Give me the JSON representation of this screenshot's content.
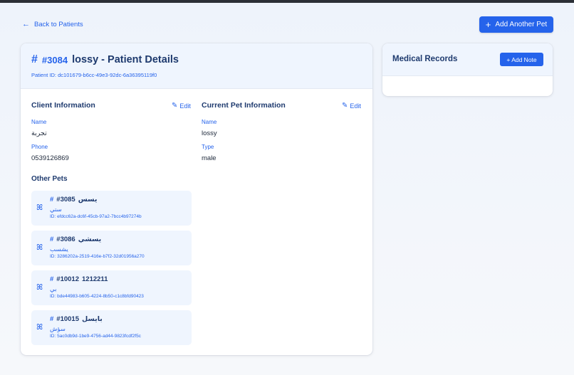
{
  "nav": {
    "back_label": "Back to Patients",
    "back_icon": "←"
  },
  "actions": {
    "add_pet_label": "Add Another Pet",
    "plus_icon": "+"
  },
  "patient": {
    "hash": "#",
    "number": "#3084",
    "title": "lossy - Patient Details",
    "id_text": "Patient ID: dc101679-b6cc-49e3-92dc-6a36395119f0"
  },
  "client": {
    "section_title": "Client Information",
    "edit_label": "Edit",
    "name_label": "Name",
    "name_value": "تجربة",
    "phone_label": "Phone",
    "phone_value": "0539126869"
  },
  "pet": {
    "section_title": "Current Pet Information",
    "edit_label": "Edit",
    "name_label": "Name",
    "name_value": "lossy",
    "type_label": "Type",
    "type_value": "male"
  },
  "other_pets": {
    "title": "Other Pets",
    "items": [
      {
        "hash": "#",
        "number": "#3085",
        "name": "يسس",
        "sub": "ستي",
        "id_text": "ID: efdcc62a-dc6f-45cb-97a2-7bcc4b97274b"
      },
      {
        "hash": "#",
        "number": "#3086",
        "name": "يسشي",
        "sub": "يشسب",
        "id_text": "ID: 3286202a-2519-416e-b7f2-32d01956a270"
      },
      {
        "hash": "#",
        "number": "#10012",
        "name": "1212211",
        "sub": "بي",
        "id_text": "ID: bde44983-b605-4224-8b50-c1c8bfd90423"
      },
      {
        "hash": "#",
        "number": "#10015",
        "name": "بايسل",
        "sub": "سؤش",
        "id_text": "ID: 5ac0db9d-1be9-4756-ad44-9823fcdf2f5c"
      }
    ]
  },
  "records": {
    "title": "Medical Records",
    "add_note_label": "+ Add Note"
  },
  "icons": {
    "pencil": "✎",
    "paw": "ꕤ"
  },
  "colors": {
    "accent": "#2563eb",
    "header_bg": "#eff5fe",
    "title_text": "#1e3a6e"
  }
}
